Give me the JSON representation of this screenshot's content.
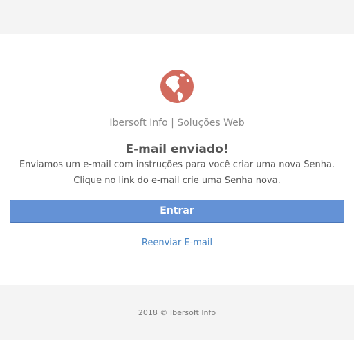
{
  "brand": {
    "name": "Ibersoft Info | Soluções Web",
    "logo_icon": "globe-icon",
    "logo_color": "#d26b5e"
  },
  "message": {
    "title": "E-mail enviado!",
    "line1": "Enviamos um e-mail com instruções para você criar uma nova Senha.",
    "line2": "Clique no link do e-mail crie uma Senha nova."
  },
  "actions": {
    "primary_label": "Entrar",
    "primary_color": "#6492d6",
    "resend_label": "Reenviar E-mail",
    "link_color": "#4a86c5"
  },
  "footer": {
    "text": "2018 © Ibersoft Info"
  }
}
